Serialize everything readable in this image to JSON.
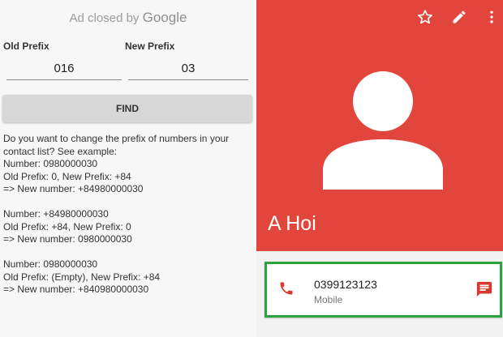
{
  "ad": {
    "prefix": "Ad closed by",
    "brand": "Google"
  },
  "form": {
    "old_label": "Old Prefix",
    "new_label": "New Prefix",
    "old_value": "016",
    "new_value": "03",
    "find_label": "FIND"
  },
  "description": {
    "intro": [
      "Do you want to change the prefix of numbers in your",
      "contact list? See example:"
    ],
    "example1": [
      "Number: 0980000030",
      "Old Prefix: 0, New Prefix: +84",
      "=> New number: +84980000030"
    ],
    "example2": [
      "Number: +84980000030",
      "Old Prefix: +84, New Prefix: 0",
      "=> New number: 0980000030"
    ],
    "example3": [
      "Number: 0980000030",
      "Old Prefix: (Empty), New Prefix: +84",
      "=> New number: +840980000030"
    ]
  },
  "contact": {
    "name": "A Hoi",
    "phone_number": "0399123123",
    "phone_type": "Mobile"
  },
  "icons": {
    "star": "star-outline-icon",
    "edit": "pencil-icon",
    "more": "more-vert-icon",
    "phone": "phone-icon",
    "message": "message-icon",
    "avatar": "person-avatar-icon"
  },
  "colors": {
    "header": "#e2453b",
    "highlight_border": "#2aa23d",
    "left_background": "#f7f7f7",
    "find_button": "#d7d7d7"
  }
}
